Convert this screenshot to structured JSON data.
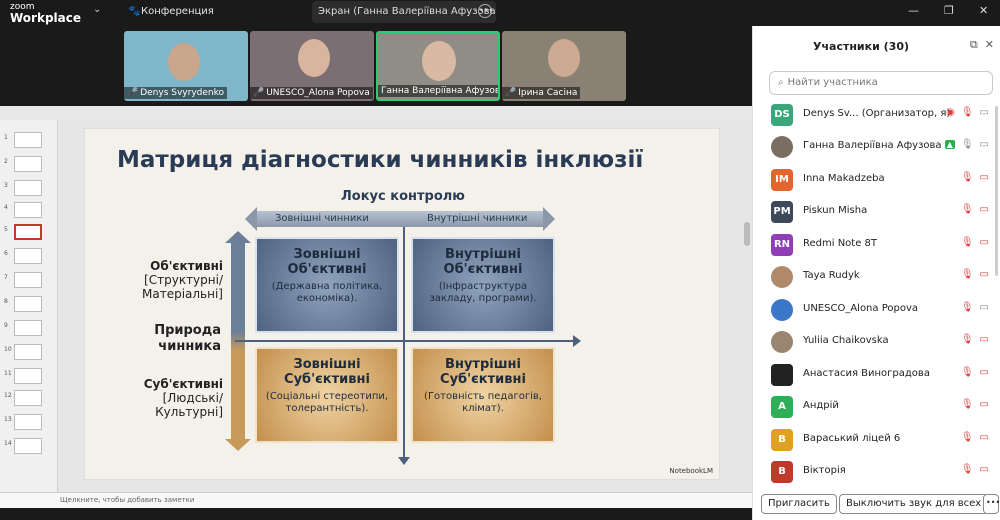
{
  "app": {
    "brand_small": "zoom",
    "brand_big": "Workplace",
    "meeting_title": "Конференция",
    "share_text": "Экран (Ганна Валеріївна Афузова"
  },
  "videos": [
    {
      "name": "Denys Svyrydenko",
      "bg": "#7fb6c9"
    },
    {
      "name": "UNESCO_Alona Popova",
      "bg": "#7c6f73"
    },
    {
      "name": "Ганна Валеріївна Афузова",
      "bg": "#8f8d85"
    },
    {
      "name": "Ірина Сасіна",
      "bg": "#8a8175"
    }
  ],
  "thumbnails": [
    "1",
    "2",
    "3",
    "4",
    "5",
    "6",
    "7",
    "8",
    "9",
    "10",
    "11",
    "12",
    "13",
    "14"
  ],
  "selected_slide": "5",
  "slide": {
    "title": "Матриця діагностики чинників інклюзії",
    "locus": "Локус контролю",
    "ext": "Зовнішні чинники",
    "int": "Внутрішні чинники",
    "obj_label_1": "Об'єктивні",
    "obj_label_2": "[Структурні/",
    "obj_label_3": "Матеріальні]",
    "nature_1": "Природа",
    "nature_2": "чинника",
    "subj_label_1": "Суб'єктивні",
    "subj_label_2": "[Людські/",
    "subj_label_3": "Культурні]",
    "q1_h1": "Зовнішні",
    "q1_h2": "Об'єктивні",
    "q1_t1": "(Державна політика,",
    "q1_t2": "економіка).",
    "q2_h1": "Внутрішні",
    "q2_h2": "Об'єктивні",
    "q2_t1": "(Інфраструктура",
    "q2_t2": "закладу, програми).",
    "q3_h1": "Зовнішні",
    "q3_h2": "Суб'єктивні",
    "q3_t1": "(Соціальні стереотипи,",
    "q3_t2": "толерантність).",
    "q4_h1": "Внутрішні",
    "q4_h2": "Суб'єктивні",
    "q4_t1": "(Готовність педагогів,",
    "q4_t2": "клімат).",
    "watermark": "NotebookLM"
  },
  "notes_placeholder": "Щелкните, чтобы добавить заметки",
  "panel": {
    "title": "Участники (30)",
    "search_placeholder": "Найти участника",
    "invite": "Пригласить",
    "mute_all": "Выключить звук для всех",
    "participants": [
      {
        "initials": "DS",
        "name": "Denys Sv...  (Организатор, я)",
        "color": "#3aa67a",
        "mic": "muted",
        "cam": "on"
      },
      {
        "initials": "",
        "name": "Ганна Валеріївна Афузова",
        "color": "#7a6e62",
        "mic": "on",
        "cam": "on"
      },
      {
        "initials": "IM",
        "name": "Inna Makadzeba",
        "color": "#e5652e",
        "mic": "muted",
        "cam": "off"
      },
      {
        "initials": "PM",
        "name": "Piskun Misha",
        "color": "#3d4858",
        "mic": "muted",
        "cam": "off"
      },
      {
        "initials": "RN",
        "name": "Redmi Note 8T",
        "color": "#8f3fb3",
        "mic": "muted",
        "cam": "off"
      },
      {
        "initials": "",
        "name": "Taya Rudyk",
        "color": "#b08a6a",
        "mic": "muted",
        "cam": "off"
      },
      {
        "initials": "",
        "name": "UNESCO_Alona Popova",
        "color": "#3a77c9",
        "mic": "muted",
        "cam": "on"
      },
      {
        "initials": "",
        "name": "Yuliia Chaikovska",
        "color": "#9b8470",
        "mic": "muted",
        "cam": "off"
      },
      {
        "initials": "",
        "name": "Анастасия Виноградова",
        "color": "#222222",
        "mic": "muted",
        "cam": "off"
      },
      {
        "initials": "A",
        "name": "Андрій",
        "color": "#2fae5a",
        "mic": "muted",
        "cam": "off"
      },
      {
        "initials": "В",
        "name": "Вараський ліцей 6",
        "color": "#e0a020",
        "mic": "muted",
        "cam": "off"
      },
      {
        "initials": "В",
        "name": "Вікторія",
        "color": "#c0392b",
        "mic": "muted",
        "cam": "off"
      }
    ]
  }
}
